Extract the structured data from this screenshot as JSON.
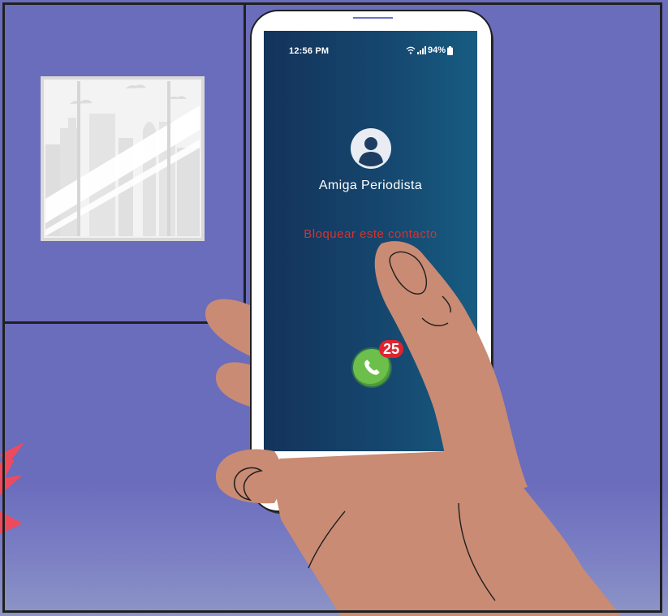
{
  "status_bar": {
    "time": "12:56 PM",
    "battery": "94%",
    "icons": [
      "wifi-icon",
      "signal-icon",
      "battery-icon"
    ]
  },
  "contact": {
    "name": "Amiga Periodista",
    "avatar_icon": "person-icon"
  },
  "actions": {
    "block_label": "Bloquear este contacto",
    "call_icon": "phone-icon",
    "missed_calls_badge": "25"
  },
  "colors": {
    "background": "#6a6cbc",
    "screen_start": "#14335a",
    "screen_end": "#175c82",
    "block_text": "#d7322d",
    "call_green": "#6cbf4a",
    "badge_red": "#e0232f",
    "skin": "#c98b74"
  }
}
